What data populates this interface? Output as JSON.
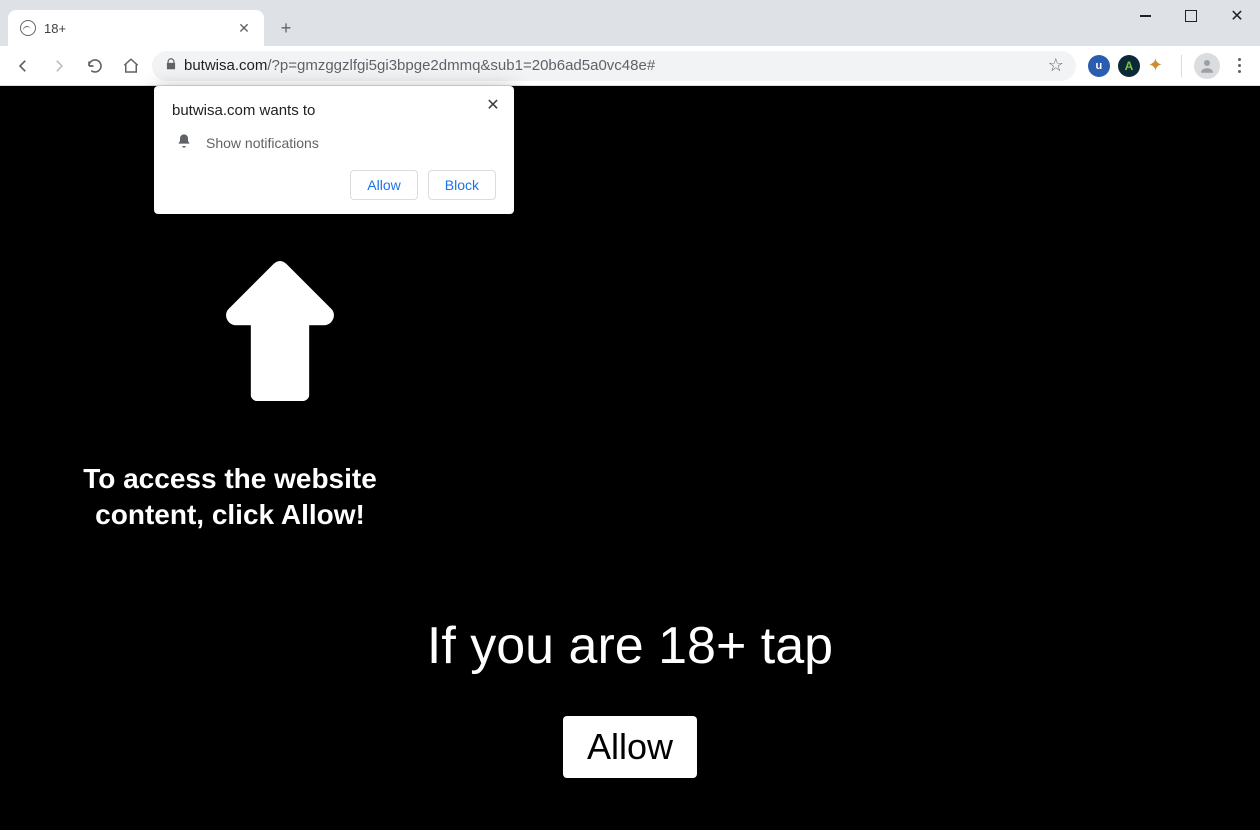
{
  "tab": {
    "title": "18+"
  },
  "address": {
    "host": "butwisa.com",
    "path": "/?p=gmzggzlfgi5gi3bpge2dmmq&sub1=20b6ad5a0vc48e#"
  },
  "permission": {
    "header": "butwisa.com wants to",
    "item": "Show notifications",
    "allow": "Allow",
    "block": "Block"
  },
  "page": {
    "instruction": "To access the website\ncontent, click Allow!",
    "headline": "If you are 18+ tap",
    "button": "Allow"
  },
  "extensions": {
    "ublock_letter": "u",
    "avast_letter": "A"
  }
}
